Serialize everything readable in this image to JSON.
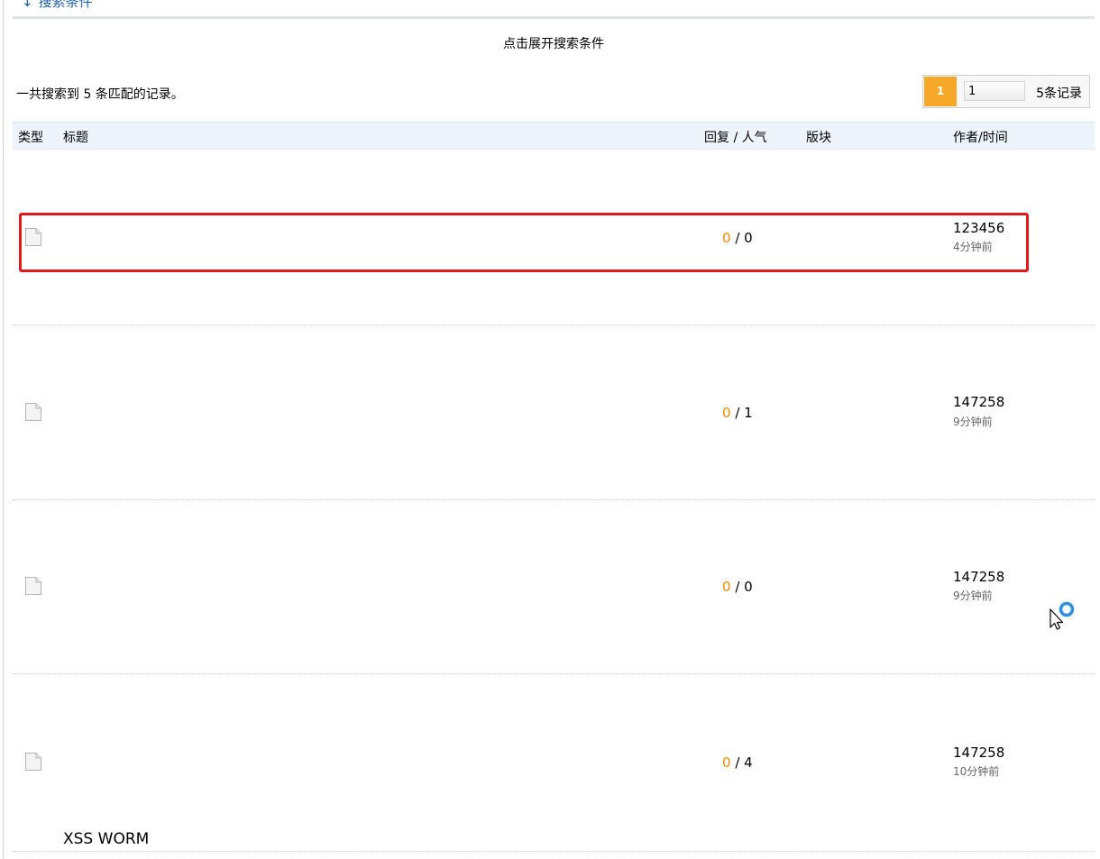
{
  "search": {
    "collapsed_label": "搜索条件",
    "expand_link": "点击展开搜索条件",
    "result_summary": "一共搜索到 5 条匹配的记录。"
  },
  "pager": {
    "current_page": "1",
    "page_input_value": "1",
    "total_label": "5条记录"
  },
  "table": {
    "headers": {
      "type": "类型",
      "title": "标题",
      "stats": "回复 / 人气",
      "forum": "版块",
      "author_time": "作者/时间"
    },
    "rows": [
      {
        "title": "",
        "replies": "0",
        "separator": " / ",
        "views": "0",
        "author": "123456",
        "time": "4分钟前"
      },
      {
        "title": "",
        "replies": "0",
        "separator": " / ",
        "views": "1",
        "author": "147258",
        "time": "9分钟前"
      },
      {
        "title": "",
        "replies": "0",
        "separator": " / ",
        "views": "0",
        "author": "147258",
        "time": "9分钟前"
      },
      {
        "title": "XSS WORM",
        "replies": "0",
        "separator": " / ",
        "views": "4",
        "author": "147258",
        "time": "10分钟前"
      }
    ]
  },
  "colors": {
    "highlight": "#e11b1b",
    "pager_active": "#f6a928",
    "reply_count": "#f08a00",
    "header_bg": "#eef4fb"
  }
}
